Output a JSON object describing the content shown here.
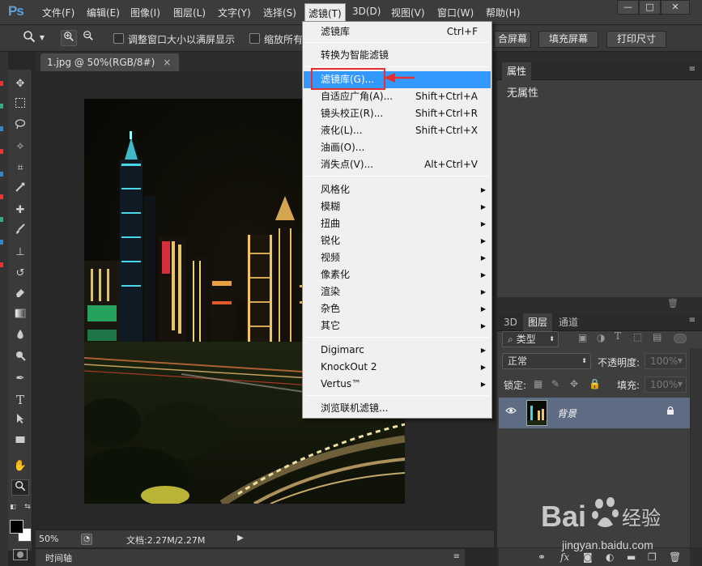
{
  "app": {
    "logo": "Ps",
    "menus": [
      "文件(F)",
      "编辑(E)",
      "图像(I)",
      "图层(L)",
      "文字(Y)",
      "选择(S)",
      "滤镜(T)",
      "3D(D)",
      "视图(V)",
      "窗口(W)",
      "帮助(H)"
    ],
    "active_menu_index": 6,
    "window_buttons": [
      "—",
      "□",
      "✕"
    ]
  },
  "options_bar": {
    "resize_windows_label": "调整窗口大小以满屏显示",
    "zoom_all_label": "缩放所有",
    "fit_screen_label": "合屏幕",
    "fill_screen_label": "填充屏幕",
    "print_size_label": "打印尺寸"
  },
  "document": {
    "tab_title": "1.jpg @ 50%(RGB/8#)",
    "tab_close": "×",
    "zoom": "50%",
    "doc_info": "文档:2.27M/2.27M"
  },
  "timeline": {
    "label": "时间轴"
  },
  "properties_panel": {
    "tab": "属性",
    "empty_text": "无属性"
  },
  "layers_panel": {
    "tabs": [
      "3D",
      "图层",
      "通道"
    ],
    "active_tab_index": 1,
    "filter_kind": "类型",
    "blend_mode": "正常",
    "opacity_label": "不透明度:",
    "opacity_value": "100%",
    "lock_label": "锁定:",
    "fill_label": "填充:",
    "fill_value": "100%",
    "layers": [
      {
        "name": "背景",
        "visible": true,
        "locked": true
      }
    ],
    "footer_icons": [
      "link-icon",
      "fx-icon",
      "mask-icon",
      "adjustment-icon",
      "folder-icon",
      "new-layer-icon",
      "trash-icon"
    ]
  },
  "filter_menu": {
    "items": [
      {
        "label": "滤镜库",
        "shortcut": "Ctrl+F"
      },
      {
        "label": "转换为智能滤镜",
        "shortcut": ""
      },
      {
        "label": "滤镜库(G)...",
        "shortcut": "",
        "highlighted": true
      },
      {
        "label": "自适应广角(A)...",
        "shortcut": "Shift+Ctrl+A"
      },
      {
        "label": "镜头校正(R)...",
        "shortcut": "Shift+Ctrl+R"
      },
      {
        "label": "液化(L)...",
        "shortcut": "Shift+Ctrl+X"
      },
      {
        "label": "油画(O)...",
        "shortcut": ""
      },
      {
        "label": "消失点(V)...",
        "shortcut": "Alt+Ctrl+V"
      },
      {
        "label": "风格化",
        "submenu": true
      },
      {
        "label": "模糊",
        "submenu": true
      },
      {
        "label": "扭曲",
        "submenu": true
      },
      {
        "label": "锐化",
        "submenu": true
      },
      {
        "label": "视频",
        "submenu": true
      },
      {
        "label": "像素化",
        "submenu": true
      },
      {
        "label": "渲染",
        "submenu": true
      },
      {
        "label": "杂色",
        "submenu": true
      },
      {
        "label": "其它",
        "submenu": true
      },
      {
        "label": "Digimarc",
        "submenu": true
      },
      {
        "label": "KnockOut 2",
        "submenu": true
      },
      {
        "label": "Vertus™",
        "submenu": true
      },
      {
        "label": "浏览联机滤镜..."
      }
    ]
  },
  "watermark": {
    "brand": "Bai",
    "brand_cn": "经验",
    "url": "jingyan.baidu.com"
  },
  "colors": {
    "accent_highlight": "#3399ff",
    "annotation_red": "#e53030",
    "layer_selected": "#5d6c82"
  }
}
